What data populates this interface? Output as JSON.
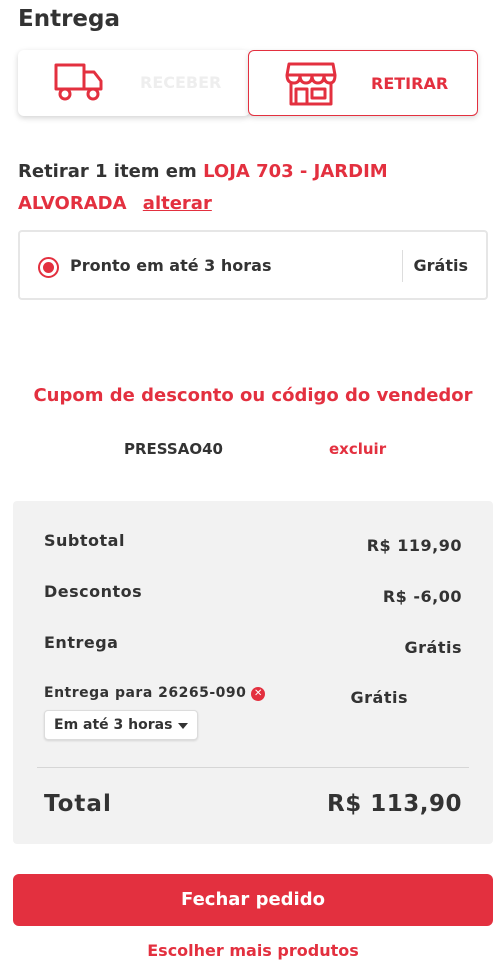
{
  "delivery": {
    "title": "Entrega",
    "options": [
      {
        "label": "RECEBER",
        "icon": "truck-icon",
        "selected": false
      },
      {
        "label": "RETIRAR",
        "icon": "store-icon",
        "selected": true
      }
    ],
    "pickup_prefix": "Retirar 1 item em",
    "store_name": "LOJA 703 - JARDIM ALVORADA",
    "change_link": "alterar",
    "shipping_option": {
      "label": "Pronto em até 3 horas",
      "price": "Grátis",
      "selected": true
    }
  },
  "coupon": {
    "title": "Cupom de desconto ou código do vendedor",
    "code": "PRESSAO40",
    "remove_label": "excluir"
  },
  "summary": {
    "subtotal_label": "Subtotal",
    "subtotal_value": "R$ 119,90",
    "discounts_label": "Descontos",
    "discounts_value": "R$ -6,00",
    "delivery_label": "Entrega",
    "delivery_value": "Grátis",
    "delivery_to_label": "Entrega para 26265-090",
    "delivery_to_value": "Grátis",
    "time_select_value": "Em até 3 horas",
    "total_label": "Total",
    "total_value": "R$ 113,90"
  },
  "actions": {
    "checkout_label": "Fechar pedido",
    "more_products_label": "Escolher mais produtos"
  },
  "colors": {
    "accent": "#e3303f",
    "text": "#333333",
    "panel": "#f2f2f2"
  }
}
